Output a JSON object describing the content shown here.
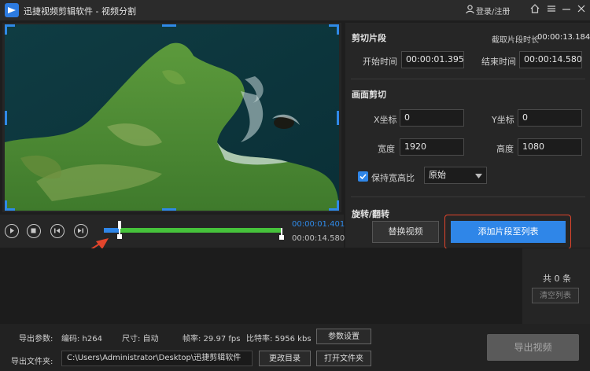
{
  "app": {
    "title": "迅捷视频剪辑软件 - 视频分割",
    "login": "登录/注册"
  },
  "player": {
    "current_time": "00:00:01.401",
    "end_time": "00:00:14.580",
    "start_fraction": 0.09,
    "end_fraction": 1.0
  },
  "clip": {
    "section_title": "剪切片段",
    "duration_label": "截取片段时长",
    "duration_value": "00:00:13.184",
    "start_label": "开始时间",
    "start_value": "00:00:01.395",
    "end_label": "结束时间",
    "end_value": "00:00:14.580"
  },
  "crop": {
    "section_title": "画面剪切",
    "x_label": "X坐标",
    "x_value": "0",
    "y_label": "Y坐标",
    "y_value": "0",
    "width_label": "宽度",
    "width_value": "1920",
    "height_label": "高度",
    "height_value": "1080",
    "keep_ratio_label": "保持宽高比",
    "ratio_value": "原始"
  },
  "rotate": {
    "section_title": "旋转/翻转"
  },
  "actions": {
    "replace_label": "替换视频",
    "add_label": "添加片段至列表"
  },
  "list": {
    "count_text": "共 0 条",
    "clear_label": "清空列表"
  },
  "export": {
    "params_label": "导出参数:",
    "codec": "编码: h264",
    "size": "尺寸: 自动",
    "fps": "帧率: 29.97 fps",
    "bitrate": "比特率: 5956 kbs",
    "settings_label": "参数设置",
    "folder_label": "导出文件夹:",
    "folder_path": "C:\\Users\\Administrator\\Desktop\\迅捷剪辑软件",
    "change_label": "更改目录",
    "open_label": "打开文件夹",
    "export_label": "导出视频"
  },
  "colors": {
    "accent": "#2f86e8",
    "highlight": "#e2452c",
    "range": "#46c33b"
  }
}
